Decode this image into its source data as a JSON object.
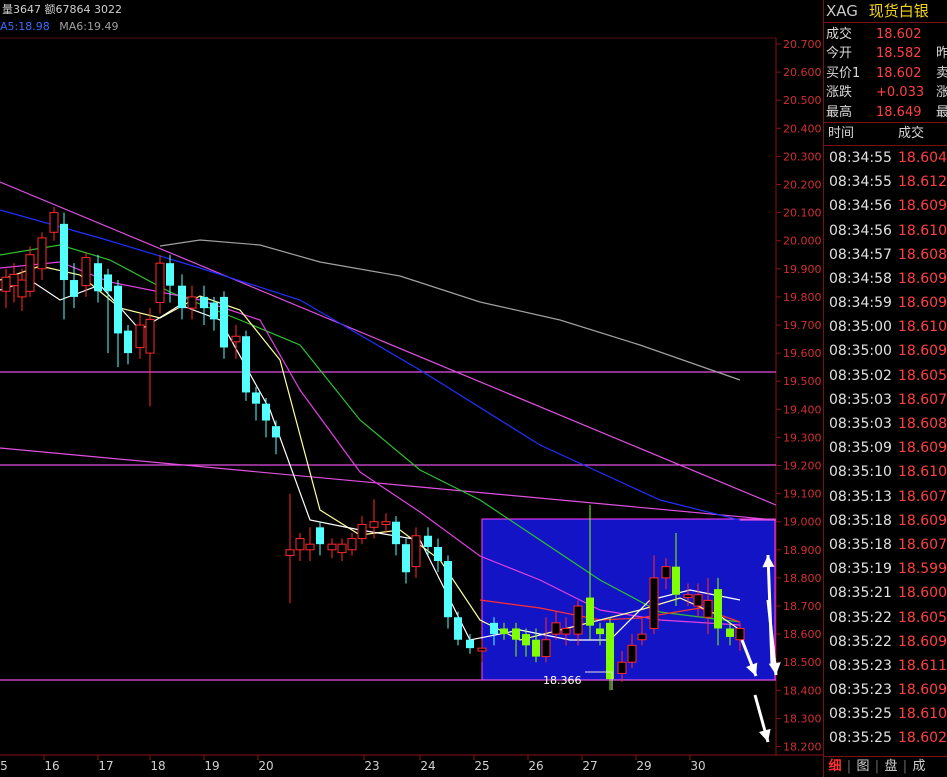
{
  "header": {
    "volume_text": "量3647 额67864 3022",
    "ma5_text": "A5:18.98",
    "ma6_text": "MA6:19.49"
  },
  "price_axis": {
    "labels": [
      "20.700",
      "20.600",
      "20.500",
      "20.400",
      "20.300",
      "20.200",
      "20.100",
      "20.000",
      "19.900",
      "19.800",
      "19.700",
      "19.600",
      "19.500",
      "19.400",
      "19.300",
      "19.200",
      "19.100",
      "19.000",
      "18.900",
      "18.800",
      "18.700",
      "18.600",
      "18.500",
      "18.400",
      "18.300",
      "18.200"
    ]
  },
  "date_axis": {
    "labels": [
      "5",
      "16",
      "17",
      "18",
      "19",
      "20",
      "23",
      "24",
      "25",
      "26",
      "27",
      "29",
      "30"
    ]
  },
  "chart_data": {
    "type": "candlestick",
    "y_range": [
      18.2,
      20.7
    ],
    "annotation_low": "18.366",
    "colors": {
      "up": "#ff2a2a",
      "down": "#54ffff",
      "down_recent": "#7fff00"
    }
  },
  "panel": {
    "code": "XAG",
    "name": "现货白银",
    "quotes": [
      {
        "label": "成交",
        "value": "18.602",
        "extra": ""
      },
      {
        "label": "今开",
        "value": "18.582",
        "extra": "昨"
      },
      {
        "label": "买价1",
        "value": "18.602",
        "extra": "卖"
      },
      {
        "label": "涨跌",
        "value": "+0.033",
        "extra": "涨"
      },
      {
        "label": "最高",
        "value": "18.649",
        "extra": "最"
      }
    ],
    "table_header": {
      "time": "时间",
      "price": "成交"
    },
    "ticks": [
      {
        "time": "08:34:55",
        "price": "18.604"
      },
      {
        "time": "08:34:55",
        "price": "18.612"
      },
      {
        "time": "08:34:56",
        "price": "18.609"
      },
      {
        "time": "08:34:56",
        "price": "18.610"
      },
      {
        "time": "08:34:57",
        "price": "18.608"
      },
      {
        "time": "08:34:58",
        "price": "18.609"
      },
      {
        "time": "08:34:59",
        "price": "18.609"
      },
      {
        "time": "08:35:00",
        "price": "18.610"
      },
      {
        "time": "08:35:00",
        "price": "18.609"
      },
      {
        "time": "08:35:02",
        "price": "18.605"
      },
      {
        "time": "08:35:03",
        "price": "18.607"
      },
      {
        "time": "08:35:03",
        "price": "18.608"
      },
      {
        "time": "08:35:09",
        "price": "18.609"
      },
      {
        "time": "08:35:10",
        "price": "18.610"
      },
      {
        "time": "08:35:13",
        "price": "18.607"
      },
      {
        "time": "08:35:18",
        "price": "18.609"
      },
      {
        "time": "08:35:18",
        "price": "18.607"
      },
      {
        "time": "08:35:19",
        "price": "18.599"
      },
      {
        "time": "08:35:21",
        "price": "18.600"
      },
      {
        "time": "08:35:22",
        "price": "18.605"
      },
      {
        "time": "08:35:22",
        "price": "18.609"
      },
      {
        "time": "08:35:23",
        "price": "18.611"
      },
      {
        "time": "08:35:23",
        "price": "18.609"
      },
      {
        "time": "08:35:25",
        "price": "18.610"
      },
      {
        "time": "08:35:25",
        "price": "18.602"
      }
    ],
    "tabs": [
      "细",
      "图",
      "盘",
      "成"
    ]
  }
}
